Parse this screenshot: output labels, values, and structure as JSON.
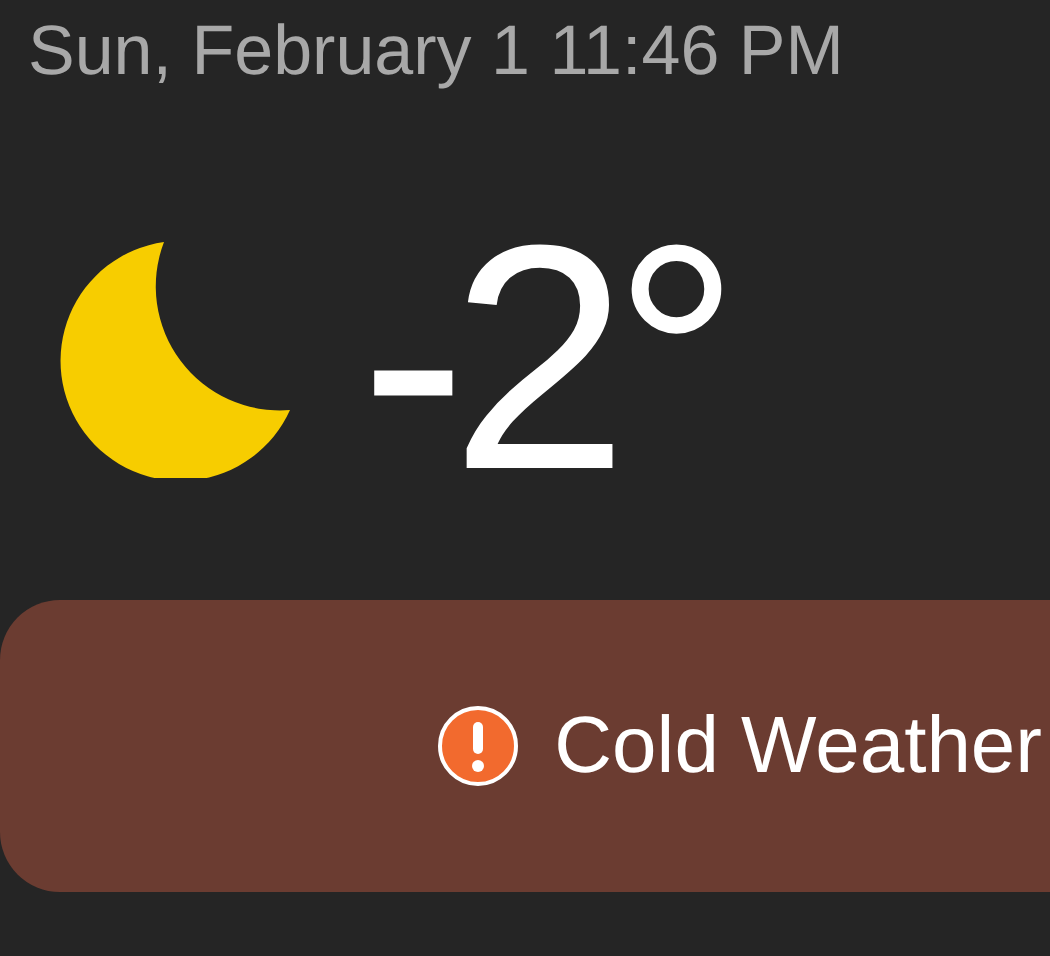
{
  "datetime": "Sun, February 1 11:46 PM",
  "current": {
    "temperature": "-2°"
  },
  "alert": {
    "text": "Cold Weather"
  }
}
